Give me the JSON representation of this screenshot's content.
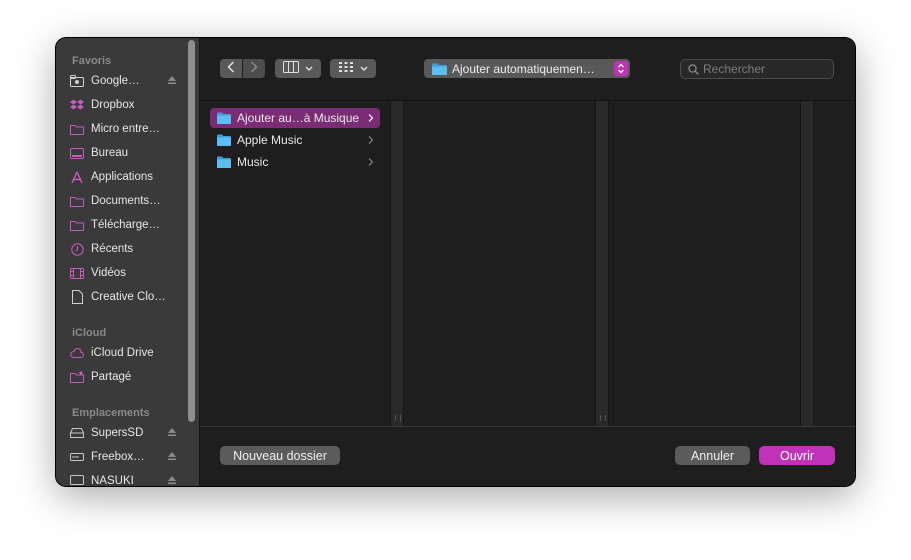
{
  "sidebar": {
    "sections": [
      {
        "title": "Favoris",
        "items": [
          {
            "label": "Google…",
            "icon": "drive-icon",
            "eject": true
          },
          {
            "label": "Dropbox",
            "icon": "dropbox-icon"
          },
          {
            "label": "Micro entre…",
            "icon": "folder-icon"
          },
          {
            "label": "Bureau",
            "icon": "desktop-icon"
          },
          {
            "label": "Applications",
            "icon": "applications-icon"
          },
          {
            "label": "Documents…",
            "icon": "folder-icon"
          },
          {
            "label": "Télécharge…",
            "icon": "folder-icon"
          },
          {
            "label": "Récents",
            "icon": "clock-icon"
          },
          {
            "label": "Vidéos",
            "icon": "film-icon"
          },
          {
            "label": "Creative Clo…",
            "icon": "document-icon"
          }
        ]
      },
      {
        "title": "iCloud",
        "items": [
          {
            "label": "iCloud Drive",
            "icon": "cloud-icon"
          },
          {
            "label": "Partagé",
            "icon": "shared-folder-icon"
          }
        ]
      },
      {
        "title": "Emplacements",
        "items": [
          {
            "label": "SupersSD",
            "icon": "disk-icon",
            "eject": true
          },
          {
            "label": "Freebox…",
            "icon": "network-icon",
            "eject": true
          },
          {
            "label": "NASUKI",
            "icon": "display-icon",
            "eject": true
          }
        ]
      }
    ]
  },
  "toolbar": {
    "path_label": "Ajouter automatiquemen…",
    "search_placeholder": "Rechercher"
  },
  "browser": {
    "items": [
      {
        "label": "Ajouter au…à Musique",
        "selected": true
      },
      {
        "label": "Apple Music",
        "selected": false
      },
      {
        "label": "Music",
        "selected": false
      }
    ]
  },
  "footer": {
    "new_folder": "Nouveau dossier",
    "cancel": "Annuler",
    "open": "Ouvrir"
  },
  "colors": {
    "accent": "#c033b9",
    "selection": "#7a2c74",
    "sidebar_icon": "#c75bc1",
    "folder": "#4fb4ec"
  }
}
